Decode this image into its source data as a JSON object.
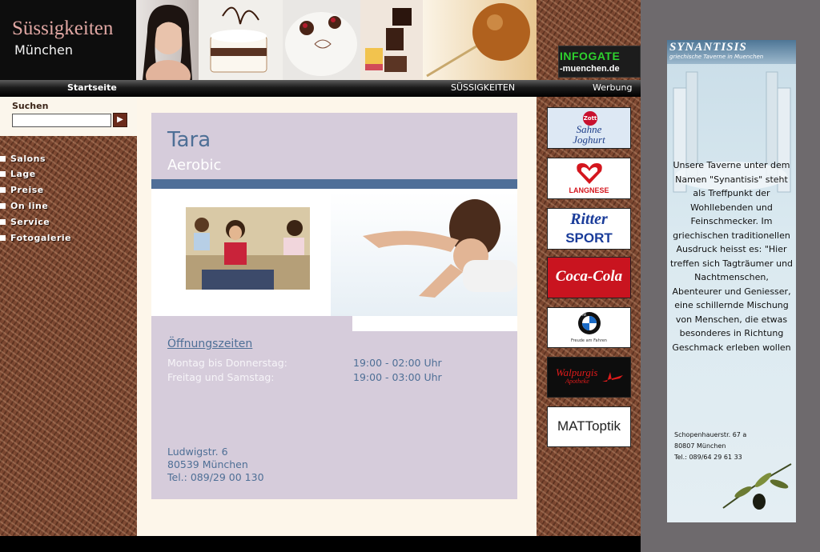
{
  "header": {
    "logo_line1": "Süssigkeiten",
    "logo_line2": "München",
    "infogate_title": "INFOGATE",
    "infogate_url": "-muenchen.de"
  },
  "nav": {
    "home": "Startseite",
    "sweets": "SÜSSIGKEITEN",
    "ads": "Werbung"
  },
  "search": {
    "label": "Suchen",
    "value": "",
    "button": "▶"
  },
  "menu": [
    "Salons",
    "Lage",
    "Preise",
    "On line",
    "Service",
    "Fotogalerie"
  ],
  "main": {
    "title": "Tara",
    "subtitle": "Aerobic",
    "hours_title": "Öffnungszeiten",
    "hours": [
      {
        "days": "Montag bis Donnerstag:",
        "time": "19:00 - 02:00 Uhr"
      },
      {
        "days": "Freitag und Samstag:",
        "time": "19:00 - 03:00 Uhr"
      }
    ],
    "street": "Ludwigstr. 6",
    "city": "80539 München",
    "phone": "Tel.: 089/29 00 130"
  },
  "sponsors": {
    "zott_brand": "Zott",
    "zott_line1": "Sahne",
    "zott_line2": "Joghurt",
    "langnese": "LANGNESE",
    "ritter_line1": "Ritter",
    "ritter_line2": "SPORT",
    "cocacola": "Coca-Cola",
    "bmw_brand": "BMW",
    "bmw_tagline": "Freude am Fahren",
    "walpurgis_line1": "Walpurgis",
    "walpurgis_line2": "Apotheke",
    "matt": "MATToptik"
  },
  "ad": {
    "logo": "SYNANTISIS",
    "tagline": "griechische Taverne in Muenchen",
    "text": "Unsere Taverne unter dem Namen \"Synantisis\" steht als Treffpunkt der Wohllebenden und Feinschmecker. Im griechischen traditionellen Ausdruck heisst es: \"Hier treffen sich Tagträumer und Nachtmenschen, Abenteurer und Geniesser, eine schillernde Mischung von Menschen, die etwas besonderes in Richtung Geschmack erleben wollen",
    "address1": "Schopenhauerstr. 67 a",
    "address2": "80807 München",
    "phone": "Tel.: 089/64 29 61 33"
  },
  "colors": {
    "accent_blue": "#4e6f96",
    "card_lilac": "#d6ccdb",
    "logo_pink": "#e0a7a3",
    "infogate_green": "#2ed12e"
  }
}
